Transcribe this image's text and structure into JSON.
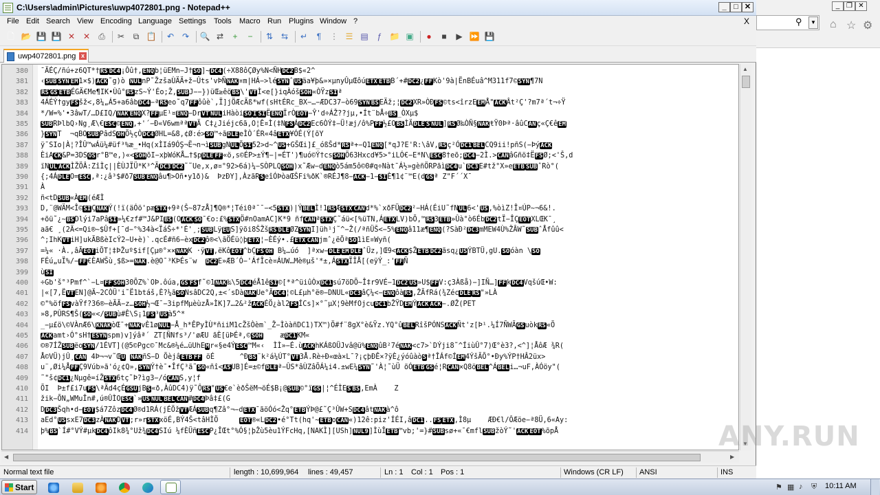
{
  "window": {
    "title": "C:\\Users\\admin\\Pictures\\uwp4072801.png - Notepad++"
  },
  "menu": [
    "File",
    "Edit",
    "Search",
    "View",
    "Encoding",
    "Language",
    "Settings",
    "Tools",
    "Macro",
    "Run",
    "Plugins",
    "Window",
    "?"
  ],
  "doc_close": "X",
  "tab": {
    "label": "uwp4072801.png"
  },
  "editor": {
    "lines": [
      {
        "n": "380",
        "t": "¯ÄÉÇ/ñú+z6QT*†[RS][DC4]¡Ôû†,[ENQ]b¦üEMn−J†[SO]]~[DC4](÷X88ôÇØy%N<ÑH[DC2]B$«2^"
      },
      {
        "n": "381",
        "t": "‹[SUB][SYN][EM]1×$)[ACK]˜g)ò [NUL]nP˜ŽzšaÙÄÄ+ž−Ûts'vÞÑ[NAK]¤m|HÁ−>lé[SYN]ˆ[US]äa¥þ&»×µnyÛµŒôú[ETX][ETB]B´+#[DC2]¿[FF]Kò'9à|ËnBÉuâ^M311f7©[SYN]¶7N"
      },
      {
        "n": "382",
        "t": "[RS][GS][ETB]ÉGÄ€Me¶IK•Ùû°[RS]zS~Ý'Éo;Ž,[SUB]J−−})üŒ≥êö[BS]\\'[VT]Ì<e[}iqÀóš[SOH]«ÒŸz[SI]ª"
      },
      {
        "n": "383",
        "t": "4ÁÉÝ†gy[FS]šž<,8¼„Á5+a6âb[DC4]−ª[RS]eo˜q7[FF]ôûè`,Ï]jÖÆcÄß*wf(sHtÉRc_BX−…−ÆDC37−ò69[SYN][BS]EÄž;¦[DC2]XR»ÒÐ[FS]©ts<îrzE[EM]Å\"[ACK]Ât²Ç'?m7ª´t¬÷Ÿ"
      },
      {
        "n": "384",
        "t": "*/W=%'•3âwT/…D£IQ/[NAK][ENQ]X?[FF]µE¹¤[ENQ]−Dr[VT][NUL]iHàòi[SO][I][SI]Ë[ENQ]ÏrÒ[EOT]−Ŷ'd÷ÁŽ??jµ,•Ít¨bÅ÷[BS]_ÒXµ$"
      },
      {
        "n": "385",
        "t": "[SUB]RÞlbQ›Ng¸Æ\\€[ESC]©[ENQ],+'´−Ð«V6wmªª[VT]Ä C‡¿Jiéjc6ã,O¦Ê¤Ì(‡N[FS]Á[DC2]Ec6ÒÝ‡−Ü!æj/ô%P[FF]½£O[BS]ÌÄ[DLE][S][NUL]][RS]Ø‰ÒÑ§[NAK]ŧŸ0Þª·âûC[AN]ç«Ç€ê[EM]"
      },
      {
        "n": "386",
        "t": "}[SYN]T  ¬qBO[SUB]PâdS[OH]Ö½çÒ[DC4]ØHL=&8,¢Ø:é>[SO]™÷ã[DLE]eÌÒ´ÉR«4â[ETX]¥ÓÉ(Ý[õY"
      },
      {
        "n": "387",
        "t": "ÿ¯SIo|À¦?ÎÛ™wÁü¼#üf³%æ_•Hq(xÌIá9ÓŞ¬Ë¬n¬ì[SUB]gN[UL]Ö[SI]52>d~^[US]+GŠŒi]£_óßŠd*[RS]ª+−Q1[ENQ][*qJ?E'R:\\âV,[RS]ç²Ó[DC1][BEL]CQ9ii!pñS(−Þý[ACK]"
      },
      {
        "n": "388",
        "t": "ÈiA[CK]&P=3DS[OS]r°B™e,)«<[SOH]õI−xþWóKÅ…†$p[DLE][FF]«ö,s©ÉP>±Ý¶−|=ÉT')¶uó©Ý†cs[SOH]Ö63Hxcd¥5>°iLÓ€−E*N\\[ESC]8†eõ;[DC4]−2Ì.>[CAN]âGñö‡Ë[FS]Ø;<'Š,d"
      },
      {
        "n": "389",
        "t": "ïN[UL][ACK]ÌŽÖÂ:ZîÌç||ÈÙJÏÜ*K³^Ã[DC3][DC2]˜˜Ue,x,ø¤°92>6á)¼−SÒPLQ[SOH])x˜Æw−d[ENQ]ò5ám5ô©0#q÷Nàt¯Á½»gèñÖRPãì[DC4]u`[DC3]E#tž°X»e[ETB][SUB]ˆRò°("
      },
      {
        "n": "390",
        "t": "{;4Á[DLE]O=[ESC],ª:¿â³$#ð7[SUB][ENQ]âu¶>Oñ•y1ð)&  ÞzÐY],ÀzãR[S]eîÓÞòaŒŠFi%ðK`®RÉJ¶8−[ACK]−1−[SI]È¶1¢¨™E(d[GS]ª Z\"F´´X¯"
      },
      {
        "n": "391",
        "t": "À"
      },
      {
        "n": "392",
        "t": "ñ<tD[SUB]«À[EM](éÆÌ"
      },
      {
        "n": "393",
        "t": "D,¨@WÄM<Î©[SI]Ç[NAK]Ý(!ï(äÓö'pæ[STX]+9ª(Š~87zÅ]¶Q®*¦Téi0ª¯¯−<5[STX])|Ý[BEL]Ì!1[RS]Æ[STX][CAN]d*%`xðFÜ[DC2]²−HÁ(ÉiU˜fN[UL]6<'[US],%òìZ!Î¤ÚP~¬6&!."
      },
      {
        "n": "394",
        "t": "+õü˜¿~[BS]Dlýi7aPâ[SI]»¼€zf#™J&PI[BS](O[ACK][SO]¯€o:£%[STX]Ö#nOamAC]K*9 ñf[CAN]ª[STX]Ç˜áü<[%üTN,Á[ETX]LV)bÕ,™[RS]3[ETB]»Ûà°ò6Éb[DC2]tÏ−ÎÇ[EOT]XLŒK¯¸"
      },
      {
        "n": "395",
        "t": "aã€ ¸(2Ä<=Qi®~$Ûf+[¯d−°%34à<ÏáŠ÷*'É'¸;[SUB]Lÿ[EU]S]ÿõi8ŠŽš[RS][DLE]ØZ[SYN]I]üh¹j˜^−Ž(/ªñÜŠ<−5%[ENQ]â11æ¶[ENQ](?SàÐ²[DC3]mMEW4Ù%ŽÂW˜[SUB]ˆÅfûû<"
      },
      {
        "n": "396",
        "t": "^;IhK[VT]iH]ukÃBßèIcÝ2−U+è)`.qcÉ#ñ6−èx[DC2]ô®<\\ãÖÉü◊þ[ETX]¦−ÈÉý•.£[ETX][CAN]jmˆ¿ëÖª[SO]1ìE¤Wyñ("
      },
      {
        "n": "397",
        "t": "=¼« ·À.,âÃ[EOT]iÕT¦‡ÞŽuº$if[Çµ®°××[NAK]K ·ÿ[VT],ëKô[EOT]^bÇ[FS][OH] B¼…úó  ]ªxw−[DLE][EM][DLE]ˆÜz,]Œ9<[ACK]$Ž[ETB][DC2]ãsq¿[US]ÝBTÜ,gU.[SO]óàn \\[SO]"
      },
      {
        "n": "398",
        "t": "FÉú„uÏ%/−[FF]€ÈAWŠù¸$ß>=[NAK].è@O¯³KÞÉs¨w  [DC2]E»ÆB´Ó−'ÁfÎcè¤ÁUW…Mè®µš'*±,Á[STX]ÏÎÅ[(eÿÝ_:'[FF]Ñ"
      },
      {
        "n": "399",
        "t": "ù[SI]"
      },
      {
        "n": "400",
        "t": "÷Gb'š°³Pmf^`−L¤[FF][SOH]30ÕZ%`OÞ.ôúa,[GS][FS]f˜©1[NAK]‰\\5[DC4]éÅ1ê[SI]©[*ª^üiûÒx[DC1]sú7öDÕ~Î‡r9VÉ−1[DC2][US]»U$[FF]V:ç3Àßå)−]IÑ…][FF]k[DC4]VqšúŒ•W:"
      },
      {
        "n": "401",
        "t": "|«[7,Ë[VT]EN]@Ä~2CÒÜ'i˜Ë1btáš,È?¼ã[SO]NsâDC2Q,±<´sDà[NAK]Ue°Ã[DC4]¦©L£µh°ë®−DNUL«[DC3]âÇ¼<−[ENQ]ôà[RS],ŽÃfRá(¾Zéc[DLE][RS]\"»LÀ"
      },
      {
        "n": "402",
        "t": "©\"%öf[FS]vàŸf?36®−èÃÃ−z…[SOH]½¬Œ¯−3ipfMµèùzÅ»ÌK]7…2&²ž[ACK]ÉÖ¿àl2[FS]ÍCs]×°˜µX¦9èMfOjcu[DC1]bŽŸD[EM]Ý[ACK][ACK]−.ØŽ(PET"
      },
      {
        "n": "403",
        "t": "»8,PÛRS¶Š([SO]«</[SUB]ù#Ê\\S¡1[FS]³[US]à5^*"
      },
      {
        "n": "404",
        "t": "_−µ£ö\\©VÀnÆ6\\[KNAK]òŒ¯+[NAK]vÈ1ø[NUL]−Å_h*ÊPyÌÙ*ñiiM1cŽšÒèm`_Ž−ÌòàñDC1)TX™)Ö#f¨8gX°è&Ÿz.YQ°û[BEL]RîšPÓNS[ACK]Ñt'z[Þ¹.¼Í7ÑWÃ[GS]uòk[RS]«Õ"
      },
      {
        "n": "405",
        "t": "[ACK]amt›Ó°sH†[ESYN]spm)v]ýâª´ ZT[ÑNfs³/'øÆU ãÈ[üÞÉª,©[SOH]    æ[DC1]KM«"
      },
      {
        "n": "406",
        "t": "©®7ÍŽ[SUB]ëo[SYN]/1ÉVT](@5©Pgc©¯Mc&®¼é…üUhE[M]r«§e4Ý[ESC]™M«‹  ÌÌ»−É.ù[ACK]hKÁßOÜJvâ@ü%[ENQ]ûB²7é[NAK]<c7>`DÝji8˜^ÍiùÛ°7)Œ°è3?,<^]¦ÅôÆ ¾R("
      },
      {
        "n": "407",
        "t": "Å©VÜ)jÛ¸[CAN] 4Þ¬¬v˜Œ[U] [NAK]ñS−D Õèjâ[ETB][FF] öÉ      ^Ð[BS]¨k²á¼ÚT°[VT]3Å.Rè÷Ð«œà×L¯?¡çþÐÊ×?ÿÈ¿ýóûàò[S]ª†ÎÁf©Í[EM]4ÝšÃÕ°•Ðy%ÝP†HÂ2üx>"
      },
      {
        "n": "408",
        "t": "u¨,Øi¼Å[FF]Ç9Vúb»ã'ó¿¢Q»,[SYN]Ý†è¯•ÎfÇ³ã˜[SO]«ñî<[AS]UB]É=±©f[DLE]ª−ÛS*âÙZâÕÁ¼i4.±wE¼[SYN]˜'À¦˜ùÜ õÓ[ETB][GS]é¦R[CAN]×Q8ö[BEL]^Á[BEL]i…¬uF,ÀÓöy\"("
      },
      {
        "n": "409",
        "t": "˜\"š¢[DC1]¿Nµgê=íŽ[STX]6tç˜Þ?ìg3−/ó[CAN]S,y¦f"
      },
      {
        "n": "410",
        "t": "ÕI  Þ±f£i7u[FS]\\ªÄd4çÉ[GSU]jB[S]«ð‚ÀûDC4)ÿ˜Ô[RS]°[US]€e`èðŠëM¬öÉ$B¡@[SUB]©°ï[GS]|¦^ÉÌE[S][BS],EmÀ    Z"
      },
      {
        "n": "411",
        "t": "žik−ÕN„WMuÎn#,ú®ÛÌO[ESC]`»[US][NUL][BEL][CAN]#[DC4]Þâ‡£(G"
      },
      {
        "n": "412",
        "t": "D[DC3]Šqh•d−[EOT]$á7Zôz[DC4]Ø®d1RÁ(jÉÖž[VT]ÆÁ[SUB]q¶Zâ°¬−d[ETX]¯ãöÓó<Žq°[ETB]ÝÞ@£˜Ç³ÛW+S[DC4]ât[NAK]à^ô"
      },
      {
        "n": "413",
        "t": "aEd°[US]sxE7[DC3]zÀ[NAK]D[VT];r»r[STX]xöÉ,BÝ4Š<tâHÌÖ     [EOT]®«L[DC2]•é°Tt(hq'~[ETB]o[CAN]«)12ê:piz'ÍÉI,â[DC1]..[FS][ETX],Ì8µ    ÆÐ€l/ÔÆöe−ª8Ü,6«Ay:"
      },
      {
        "n": "414",
        "t": "þ%[BS]`Í#°VÝ#µk[DC4]ôIk8¾°Už¾[DC4]SIú ¼fÈÜñ[ESC]P¿ÎŒt°%Ó§¦þŽù5èu1ÝFcHq,[NAKÌ][USh][NUL9]]ÌùÎ[ETB]™vb;'=}#[SUB]sø+«¯€mfl[SUB]žòÝ˜'[ACK][EOT]%õpÅ"
      }
    ]
  },
  "status": {
    "file_type": "Normal text file",
    "length": "length : 10,699,964",
    "lines": "lines : 49,457",
    "ln": "Ln : 1",
    "col": "Col : 1",
    "pos": "Pos : 1",
    "eol": "Windows (CR LF)",
    "encoding": "ANSI",
    "ins": "INS"
  },
  "taskbar": {
    "start_label": "Start",
    "clock": "10:11 AM"
  },
  "watermark": "ANY.RUN",
  "colors": {
    "title_gradient_top": "#eaf1fb",
    "tab_accent": "#f5a623",
    "control_char_bg": "#000000",
    "gutter": "#e4e4e4"
  },
  "icons": {
    "toolbar": [
      "new-file-icon",
      "open-file-icon",
      "save-icon",
      "save-all-icon",
      "close-icon",
      "close-all-icon",
      "print-icon",
      "cut-icon",
      "copy-icon",
      "paste-icon",
      "undo-icon",
      "redo-icon",
      "find-icon",
      "replace-icon",
      "zoom-in-icon",
      "zoom-out-icon",
      "sync-v-icon",
      "sync-h-icon",
      "word-wrap-icon",
      "show-all-chars-icon",
      "indent-guide-icon",
      "lang-icon",
      "doc-map-icon",
      "function-list-icon",
      "folder-workspace-icon",
      "monitor-icon",
      "record-macro-icon",
      "stop-record-icon",
      "play-macro-icon",
      "play-multiple-icon",
      "save-macro-icon"
    ]
  }
}
